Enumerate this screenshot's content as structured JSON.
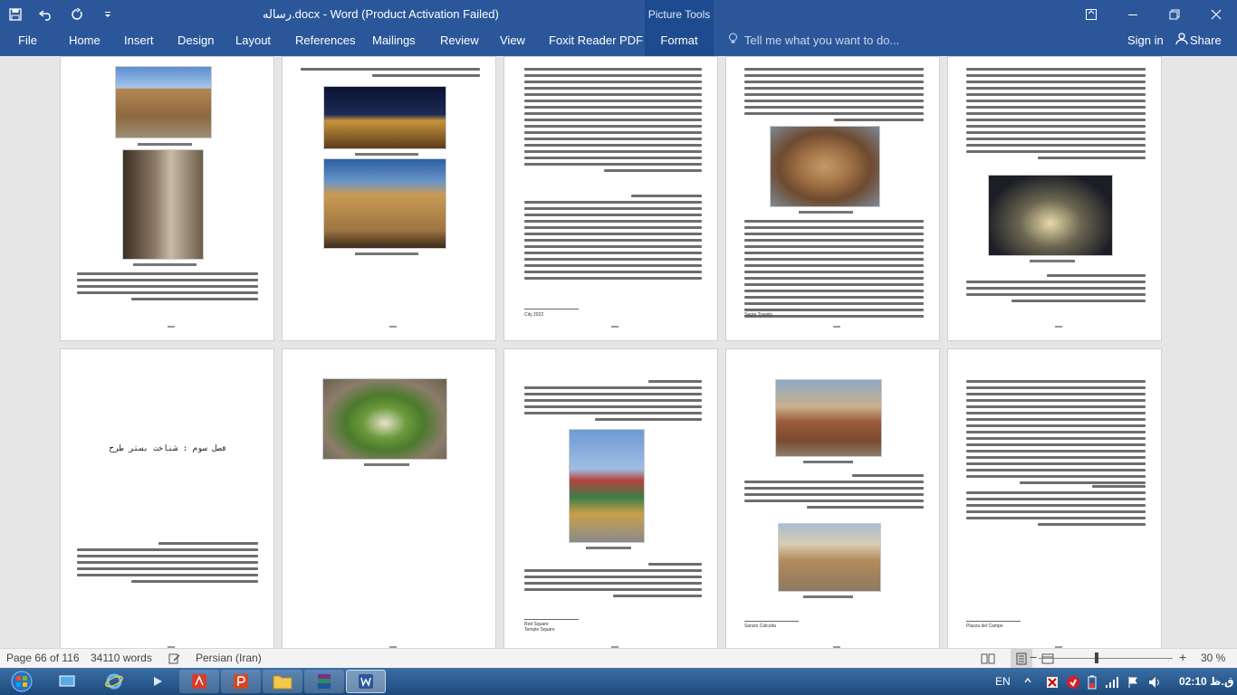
{
  "window": {
    "title": "رساله.docx - Word (Product Activation Failed)",
    "context_tools": "Picture Tools"
  },
  "qat": {
    "save_icon": "save-icon",
    "undo_icon": "undo-icon",
    "redo_icon": "redo-icon",
    "customize_icon": "customize-icon"
  },
  "ribbon": {
    "tabs": [
      "File",
      "Home",
      "Insert",
      "Design",
      "Layout",
      "References",
      "Mailings",
      "Review",
      "View",
      "Foxit Reader PDF",
      "Format"
    ],
    "tell_me": "Tell me what you want to do...",
    "sign_in": "Sign in",
    "share": "Share"
  },
  "document": {
    "chapter_heading": "فصل سوم : شناخت بستر طرح",
    "footnotes": [
      "City 2022",
      "Segre Travels",
      "Red Square",
      "Temple Square",
      "Sanzio Calcutta",
      "Piazza del Campo"
    ]
  },
  "status": {
    "page": "Page 66 of 116",
    "words": "34110 words",
    "language": "Persian (Iran)",
    "zoom": "30 %",
    "zoom_percent": 30
  },
  "taskbar": {
    "lang": "EN",
    "time": "02:10 ق.ظ"
  },
  "colors": {
    "accent": "#2b579a",
    "accent_dark": "#1e4b8f"
  }
}
